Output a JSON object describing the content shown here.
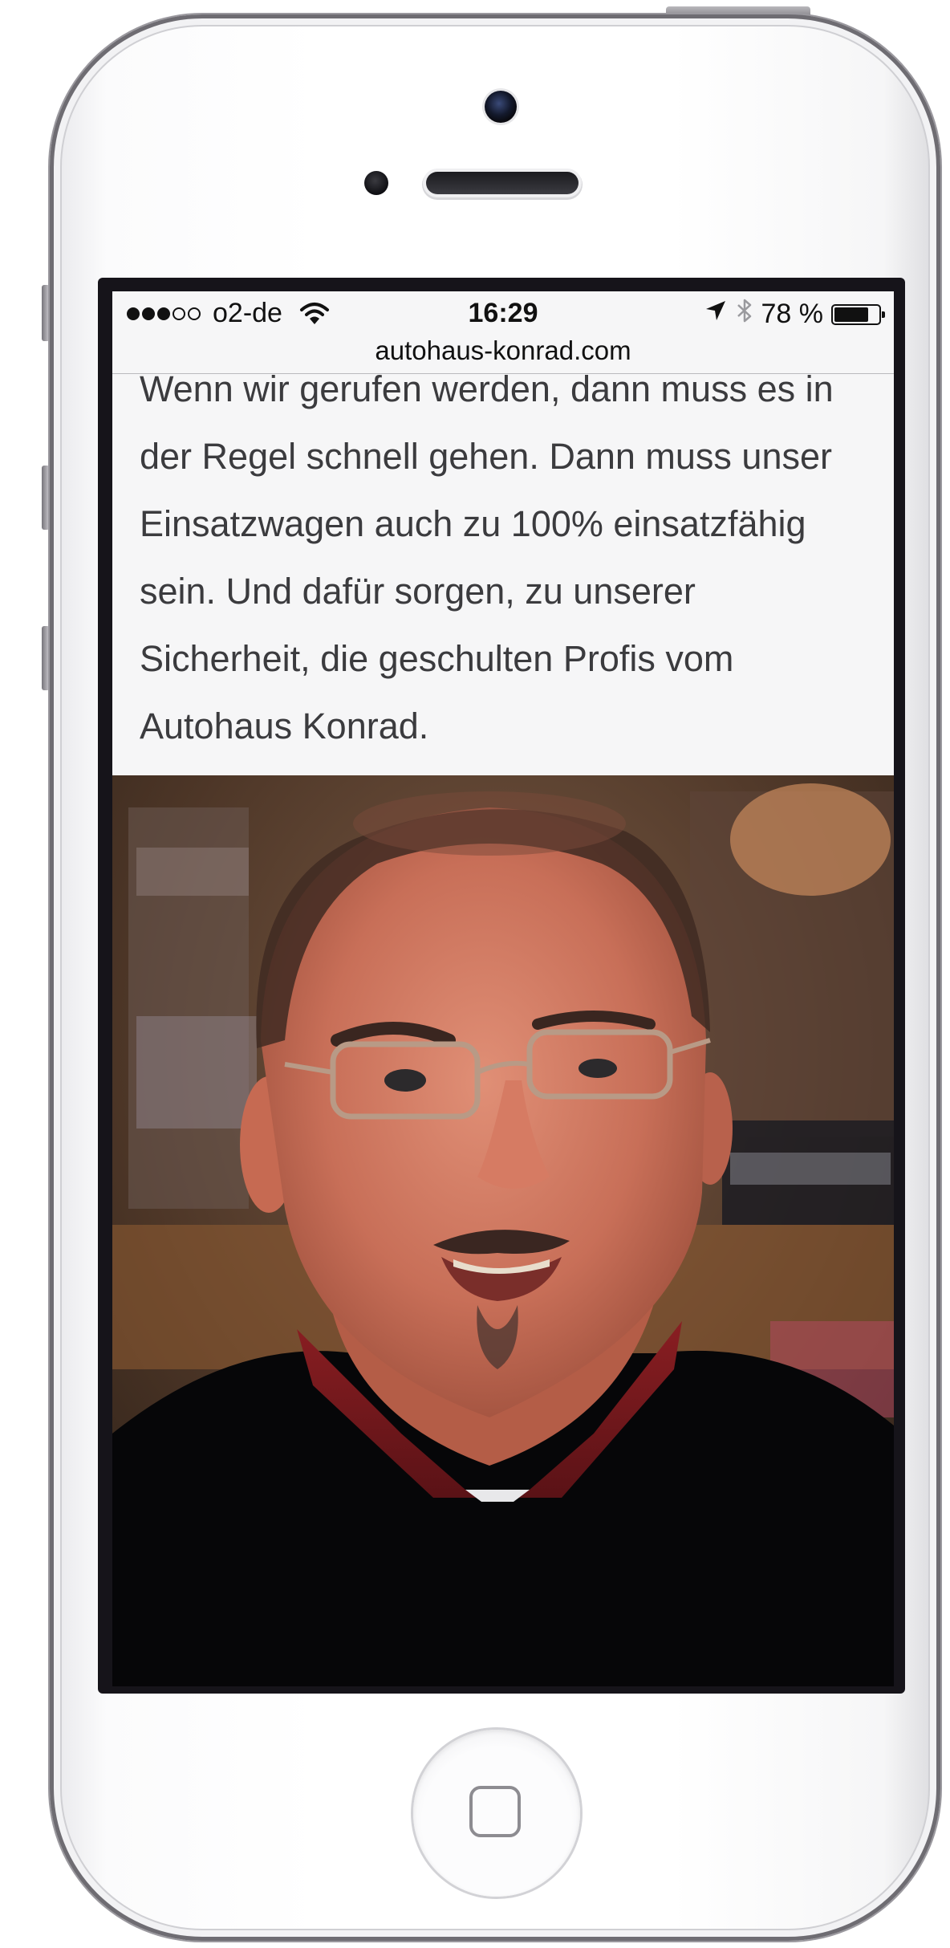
{
  "status_bar": {
    "carrier": "o2-de",
    "signal_bars_filled": 3,
    "signal_bars_total": 5,
    "time": "16:29",
    "battery": "78 %",
    "battery_level": 0.78,
    "icons": [
      "signal-dots-icon",
      "wifi-icon",
      "location-arrow-icon",
      "bluetooth-icon",
      "battery-icon"
    ]
  },
  "browser": {
    "url": "autohaus-konrad.com"
  },
  "article": {
    "partial_line": "Wenn wir gerufen werden, dann muss es in",
    "lines": [
      "der Regel schnell gehen. Dann muss unser",
      "Einsatzwagen auch zu 100% einsatzfähig",
      "sein. Und dafür sorgen, zu unserer",
      "Sicherheit, die geschulten Profis vom",
      "Autohaus Konrad."
    ]
  },
  "photo": {
    "subject": "portrait-photo"
  },
  "device": {
    "home_button_icon": "home-square-icon"
  }
}
